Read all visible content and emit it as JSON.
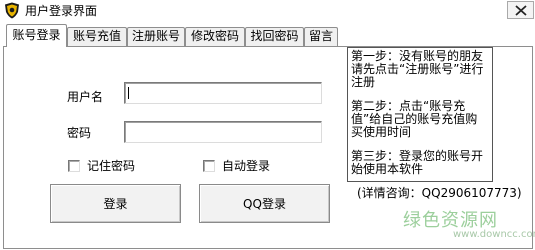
{
  "window": {
    "title": "用户登录界面",
    "icon": "shield-badge-icon"
  },
  "tabs": [
    {
      "label": "账号登录",
      "active": true
    },
    {
      "label": "账号充值",
      "active": false
    },
    {
      "label": "注册账号",
      "active": false
    },
    {
      "label": "修改密码",
      "active": false
    },
    {
      "label": "找回密码",
      "active": false
    },
    {
      "label": "留言",
      "active": false
    }
  ],
  "login": {
    "username_label": "用户名",
    "username_value": "",
    "password_label": "密码",
    "password_value": "",
    "remember_label": "记住密码",
    "remember_checked": false,
    "autologin_label": "自动登录",
    "autologin_checked": false,
    "login_button": "登录",
    "qq_button": "QQ登录"
  },
  "info": {
    "step1": "第一步：没有账号的朋友请先点击“注册账号”进行注册",
    "step2": "第二步：点击“账号充值”给自己的账号充值购买使用时间",
    "step3": "第三步：登录您的账号开始使用本软件",
    "contact": "(详情咨询：QQ2906107773)"
  },
  "watermark": {
    "text": "绿色资源网",
    "url": "www.downcc.com"
  },
  "colors": {
    "watermark_green": "#9ccf9c",
    "tab_inactive": "#f0f0f0",
    "button_face": "#f2f2f2"
  }
}
